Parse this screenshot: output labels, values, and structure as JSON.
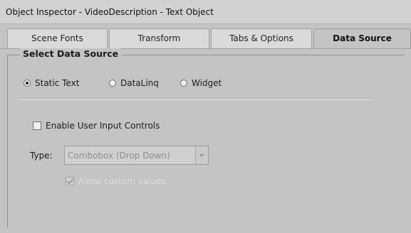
{
  "window": {
    "title": "Object Inspector - VideoDescription - Text Object"
  },
  "tabs": [
    {
      "label": "Scene Fonts"
    },
    {
      "label": "Transform"
    },
    {
      "label": "Tabs & Options"
    },
    {
      "label": "Data Source",
      "active": true
    }
  ],
  "group": {
    "title": "Select Data Source"
  },
  "radios": {
    "static_text": {
      "label": "Static Text",
      "selected": true
    },
    "dataling": {
      "label": "DataLinq",
      "selected": false
    },
    "widget": {
      "label": "Widget",
      "selected": false
    }
  },
  "enable_user_input": {
    "label": "Enable User Input Controls",
    "checked": false
  },
  "type": {
    "label": "Type:",
    "value": "Combobox (Drop Down)",
    "enabled": false
  },
  "allow_custom": {
    "label": "Allow custom values",
    "checked": true,
    "enabled": false
  },
  "colors": {
    "background": "#c4c4c4",
    "active_tab": "#c4c4c4",
    "inactive_tab": "#dadada"
  }
}
